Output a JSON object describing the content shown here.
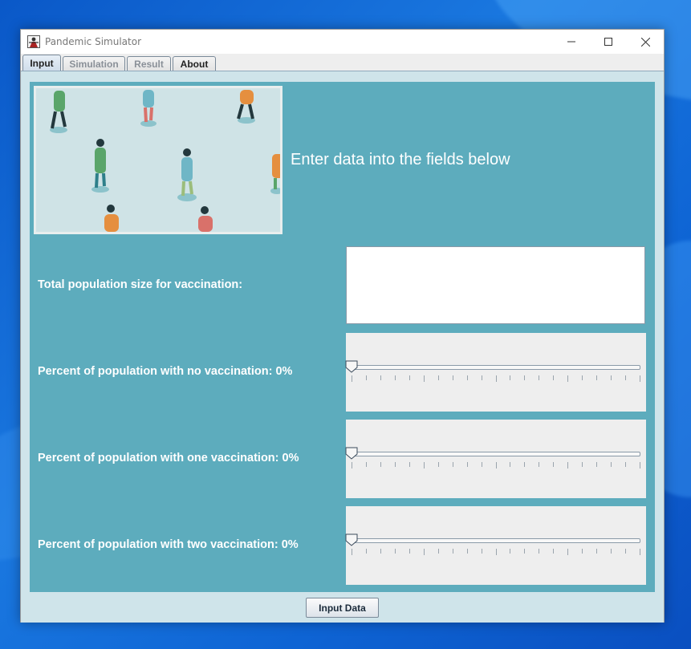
{
  "window": {
    "title": "Pandemic Simulator",
    "controls": [
      "minimize-icon",
      "maximize-icon",
      "close-icon"
    ]
  },
  "tabs": [
    {
      "label": "Input",
      "active": true
    },
    {
      "label": "Simulation",
      "active": false
    },
    {
      "label": "Result",
      "active": false
    },
    {
      "label": "About",
      "active": false
    }
  ],
  "input_panel": {
    "heading": "Enter data into the fields below",
    "population_label": "Total population size for vaccination:",
    "population_value": "",
    "sliders": [
      {
        "label": "Percent of population with no vaccination: 0%",
        "value": 0,
        "min": 0,
        "max": 100
      },
      {
        "label": "Percent of population with one vaccination: 0%",
        "value": 0,
        "min": 0,
        "max": 100
      },
      {
        "label": "Percent of population with two vaccination: 0%",
        "value": 0,
        "min": 0,
        "max": 100
      }
    ],
    "submit_label": "Input Data"
  },
  "colors": {
    "panel_bg": "#5dacbd",
    "content_bg": "#cfe4ea",
    "desktop_bg": "#0f66d6"
  }
}
